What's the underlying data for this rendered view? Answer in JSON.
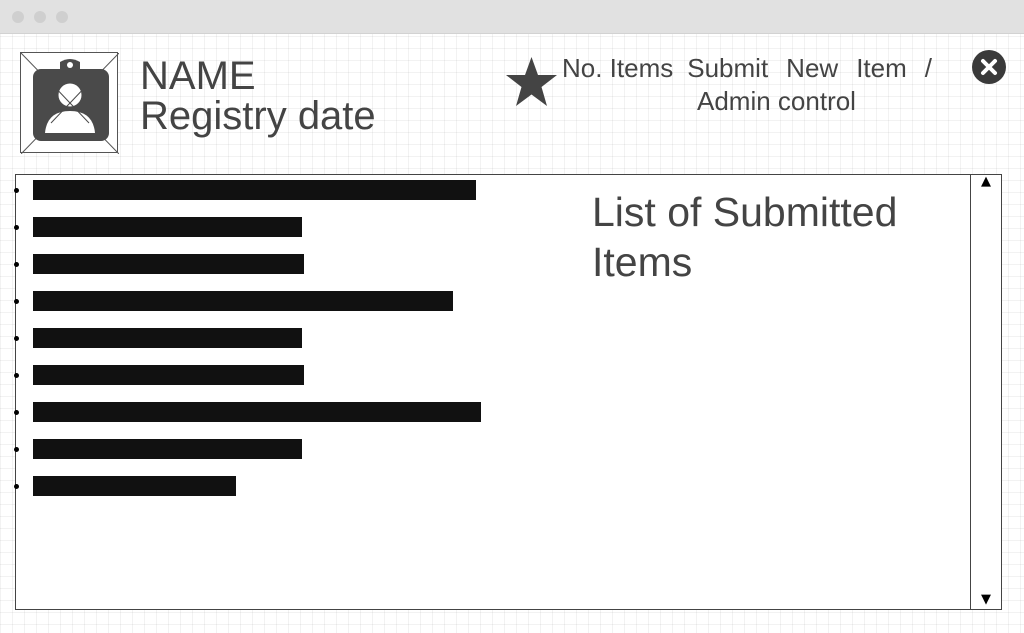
{
  "profile": {
    "name": "NAME",
    "registry_date": "Registry date",
    "avatar_icon": "id-badge-user-icon"
  },
  "nav": {
    "star_icon": "star-icon",
    "items": [
      "No. Items",
      "Submit",
      "New",
      "Item",
      "/"
    ],
    "admin_label": "Admin control",
    "close_icon": "close-icon"
  },
  "list": {
    "title": "List of Submitted Items",
    "items": [
      {
        "redacted": true
      },
      {
        "redacted": true
      },
      {
        "redacted": true
      },
      {
        "redacted": true
      },
      {
        "redacted": true
      },
      {
        "redacted": true
      },
      {
        "redacted": true
      },
      {
        "redacted": true
      },
      {
        "redacted": true
      }
    ]
  },
  "scrollbar": {
    "up_arrow": "▲",
    "down_arrow": "▼"
  },
  "colors": {
    "text": "#444444",
    "redaction": "#111111",
    "icon": "#3a3a3a"
  }
}
